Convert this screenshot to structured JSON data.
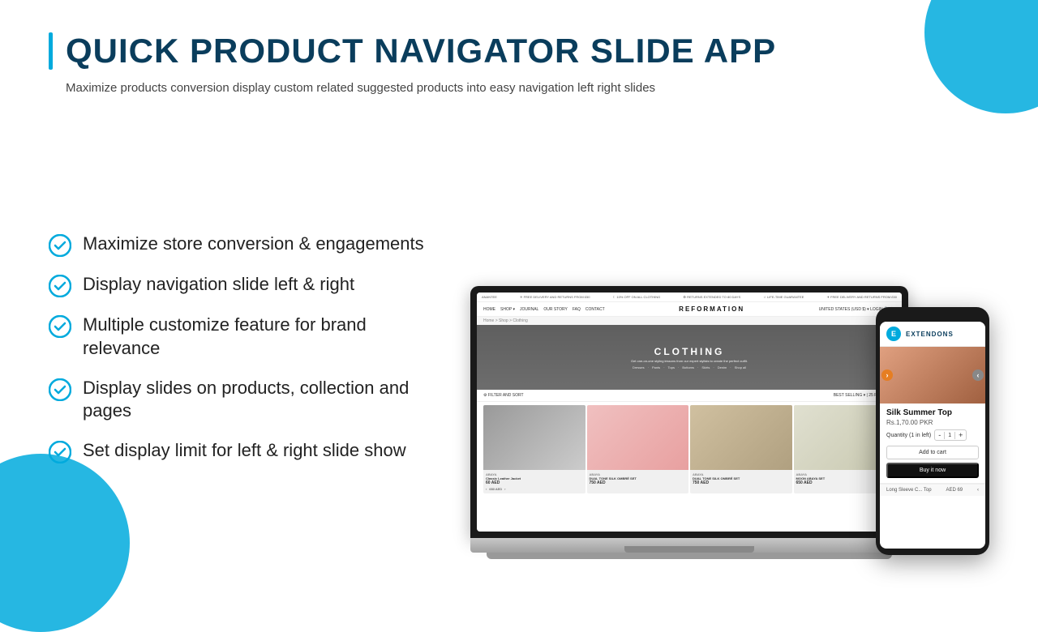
{
  "colors": {
    "accent": "#00aadd",
    "dark": "#0a3d5c",
    "text": "#222222",
    "subtitle": "#444444"
  },
  "header": {
    "title": "QUICK PRODUCT NAVIGATOR SLIDE APP",
    "subtitle": "Maximize products conversion display custom related suggested products into easy navigation left right slides"
  },
  "features": [
    {
      "id": 1,
      "text": "Maximize store conversion & engagements"
    },
    {
      "id": 2,
      "text": "Display navigation slide left & right"
    },
    {
      "id": 3,
      "text": "Multiple customize feature for brand relevance"
    },
    {
      "id": 4,
      "text": "Display slides on products, collection and pages"
    },
    {
      "id": 5,
      "text": "Set display limit for left & right slide show"
    }
  ],
  "laptop": {
    "website": {
      "topbar": "FREE DELIVERY AND RETURNS FROM £50   |   10% OFF ON ALL CLOTHING   |   RETURNS EXTENDED TO 80 DAYS   |   LIFE-TIME GUARANTEE",
      "nav_links": [
        "HOME",
        "SHOP",
        "JOURNAL",
        "OUR STORY",
        "FAQ",
        "CONTACT"
      ],
      "logo": "REFORMATION",
      "hero_title": "CLOTHING",
      "hero_sub": "Get one-on-one styling lessons from our expert stylists to create the perfect outfit.",
      "hero_links": [
        "Dresses",
        "Pants",
        "Tops",
        "Bottoms",
        "Skirts",
        "Denim",
        "Shop all"
      ],
      "products": [
        {
          "label": "ABAYA",
          "name": "Classic Leather Jacket",
          "price": "60 AED",
          "color": "gray"
        },
        {
          "label": "ABAYA",
          "name": "DUAL TONE SILK OMBRÉ SET",
          "price": "750 AED",
          "color": "pink"
        },
        {
          "label": "ABAYA",
          "name": "DUAL TONE SILK OMBRÉ SET",
          "price": "750 AED",
          "color": "beige"
        },
        {
          "label": "ABAYA",
          "name": "MOON ABAYA SET",
          "price": "650 AED",
          "color": "light"
        }
      ]
    }
  },
  "phone": {
    "brand": "EXTENDONS",
    "slide_title": "Silk Summer Top",
    "slide_price": "Rs.1,70.00 PKR",
    "product_detail": "Long Sleeve C... Top",
    "product_price_aed": "AED 69",
    "qty_label": "Quantity (1 in left)",
    "qty_value": "1",
    "add_to_cart_label": "Add to cart",
    "buy_it_now_label": "Buy it now"
  }
}
